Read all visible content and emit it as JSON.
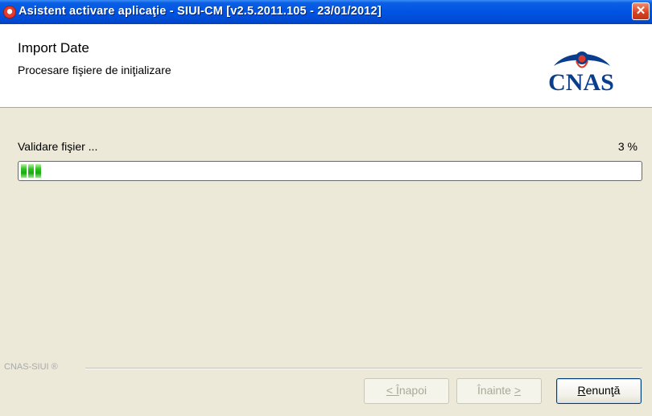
{
  "window": {
    "title": "Asistent activare aplicaţie - SIUI-CM [v2.5.2011.105 - 23/01/2012]",
    "close_glyph": "✕",
    "icon": "app-icon"
  },
  "header": {
    "title": "Import Date",
    "subtitle": "Procesare fişiere de iniţializare",
    "logo_text": "CNAS",
    "logo_colors": {
      "primary": "#0a3e8c",
      "accent": "#d93a2b"
    }
  },
  "progress": {
    "status": "Validare fişier ...",
    "percent_label": "3 %",
    "fraction": 0.03,
    "color": "#2fc121"
  },
  "footer": {
    "brand": "CNAS-SIUI ®",
    "buttons": {
      "back": {
        "hotkey": "Î",
        "rest": "napoi",
        "prefix": "< "
      },
      "next": {
        "label": "Înainte ",
        "hotkey": ">"
      },
      "cancel": {
        "hotkey": "R",
        "rest": "enunţă"
      }
    }
  }
}
